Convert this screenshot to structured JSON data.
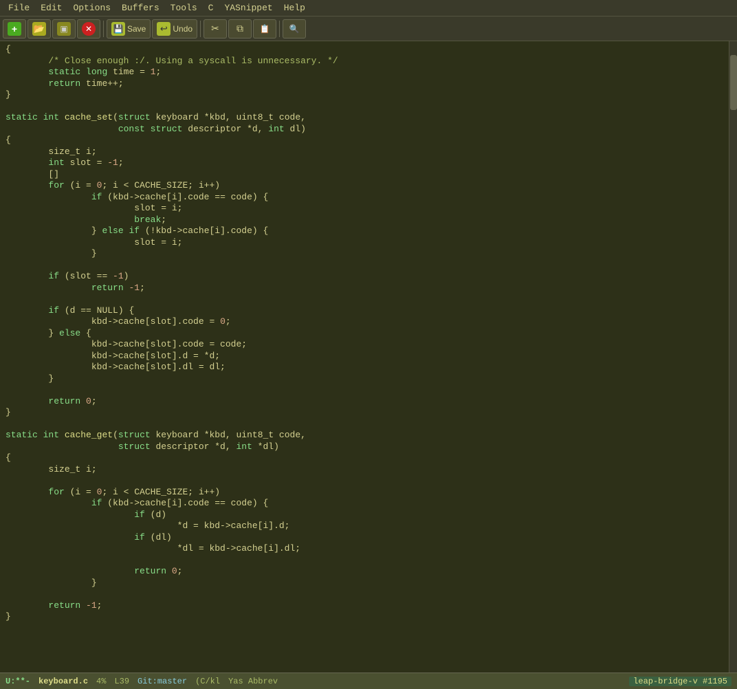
{
  "menubar": {
    "items": [
      "File",
      "Edit",
      "Options",
      "Buffers",
      "Tools",
      "C",
      "YASnippet",
      "Help"
    ]
  },
  "toolbar": {
    "buttons": [
      {
        "name": "new-file-button",
        "icon": "icon-new",
        "label": ""
      },
      {
        "name": "open-file-button",
        "icon": "icon-open",
        "label": ""
      },
      {
        "name": "save-file-button",
        "icon": "icon-save-file",
        "label": ""
      },
      {
        "name": "close-button",
        "icon": "icon-close",
        "label": ""
      },
      {
        "name": "save-disk-button",
        "icon": "icon-save-disk",
        "label": "Save"
      },
      {
        "name": "undo-button",
        "icon": "icon-undo",
        "label": "Undo"
      },
      {
        "name": "cut-button",
        "icon": "icon-cut",
        "label": ""
      },
      {
        "name": "copy-button",
        "icon": "icon-copy",
        "label": ""
      },
      {
        "name": "paste-button",
        "icon": "icon-paste",
        "label": ""
      },
      {
        "name": "search-button",
        "icon": "icon-search",
        "label": ""
      }
    ]
  },
  "statusbar": {
    "mode": "U:**-",
    "filename": "keyboard.c",
    "percent": "4%",
    "line": "L39",
    "git": "Git:master",
    "encoding": "(C/kl",
    "abbrev": "Yas Abbrev",
    "tail": "leap-bridge-v #1195"
  },
  "code": {
    "lines": [
      "{",
      "        /* Close enough :/. Using a syscall is unnecessary. */",
      "        static long time = 1;",
      "        return time++;",
      "}",
      "",
      "static int cache_set(struct keyboard *kbd, uint8_t code,",
      "                     const struct descriptor *d, int dl)",
      "{",
      "        size_t i;",
      "        int slot = -1;",
      "        []",
      "        for (i = 0; i < CACHE_SIZE; i++)",
      "                if (kbd->cache[i].code == code) {",
      "                        slot = i;",
      "                        break;",
      "                } else if (!kbd->cache[i].code) {",
      "                        slot = i;",
      "                }",
      "",
      "        if (slot == -1)",
      "                return -1;",
      "",
      "        if (d == NULL) {",
      "                kbd->cache[slot].code = 0;",
      "        } else {",
      "                kbd->cache[slot].code = code;",
      "                kbd->cache[slot].d = *d;",
      "                kbd->cache[slot].dl = dl;",
      "        }",
      "",
      "        return 0;",
      "}",
      "",
      "static int cache_get(struct keyboard *kbd, uint8_t code,",
      "                     struct descriptor *d, int *dl)",
      "{",
      "        size_t i;",
      "",
      "        for (i = 0; i < CACHE_SIZE; i++)",
      "                if (kbd->cache[i].code == code) {",
      "                        if (d)",
      "                                *d = kbd->cache[i].d;",
      "                        if (dl)",
      "                                *dl = kbd->cache[i].dl;",
      "",
      "                        return 0;",
      "                }",
      "",
      "        return -1;",
      "}"
    ]
  }
}
